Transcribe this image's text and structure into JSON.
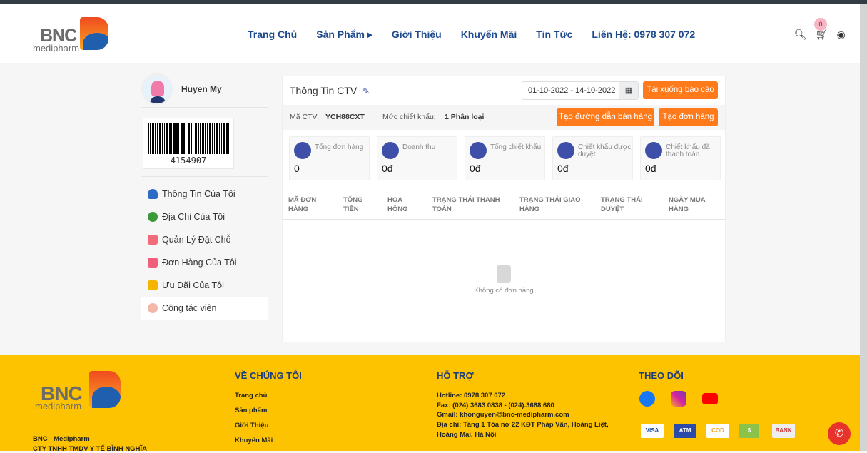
{
  "header": {
    "logo_text": "BNC medipharm",
    "nav": [
      "Trang Chủ",
      "Sản Phẩm ▸",
      "Giới Thiệu",
      "Khuyến Mãi",
      "Tin Tức",
      "Liên Hệ: 0978 307 072"
    ],
    "cart_count": "0"
  },
  "sidebar": {
    "user_name": "Huyen My",
    "barcode": "4154907",
    "items": [
      {
        "label": "Thông Tin Của Tôi",
        "color": "#2b6cc4"
      },
      {
        "label": "Địa Chỉ Của Tôi",
        "color": "#3a9a3a"
      },
      {
        "label": "Quản Lý Đặt Chỗ",
        "color": "#f26b7a"
      },
      {
        "label": "Đơn Hàng Của Tôi",
        "color": "#f0607a"
      },
      {
        "label": "Ưu Đãi Của Tôi",
        "color": "#f5b400"
      },
      {
        "label": "Cộng tác viên",
        "color": "#f4b8a8"
      }
    ]
  },
  "panel": {
    "title": "Thông Tin CTV",
    "date_range": "01-10-2022 - 14-10-2022",
    "download_btn": "Tải xuống báo cáo",
    "ctv_label": "Mã CTV:",
    "ctv_code": "YCH88CXT",
    "discount_label": "Mức chiết khấu:",
    "discount_value": "1 Phân loại",
    "link_btn": "Tạo đường dẫn bán hàng",
    "order_btn": "Tạo đơn hàng",
    "stats": [
      {
        "label": "Tổng đơn hàng",
        "value": "0"
      },
      {
        "label": "Doanh thu",
        "value": "0đ"
      },
      {
        "label": "Tổng chiết khấu",
        "value": "0đ"
      },
      {
        "label": "Chiết khấu được duyệt",
        "value": "0đ"
      },
      {
        "label": "Chiết khấu đã thanh toán",
        "value": "0đ"
      }
    ],
    "columns": [
      "MÃ ĐƠN HÀNG",
      "TỔNG TIỀN",
      "HOA HỒNG",
      "TRẠNG THÁI THANH TOÁN",
      "TRẠNG THÁI GIAO HÀNG",
      "TRẠNG THÁI DUYỆT",
      "NGÀY MUA HÀNG"
    ],
    "empty": "Không có đơn hàng"
  },
  "footer": {
    "company": "BNC - Medipharm",
    "company_full": "CTY TNHH TMDV Y TẾ BÌNH NGHĨA",
    "about_title": "VỀ CHÚNG TÔI",
    "about_links": [
      "Trang chủ",
      "Sản phẩm",
      "Giới Thiệu",
      "Khuyến Mãi"
    ],
    "support_title": "HỖ TRỢ",
    "support_lines": [
      "Hotline: 0978 307 072",
      "Fax: (024) 3683 0838 - (024).3668 680",
      "Gmail: khonguyen@bnc-medipharm.com",
      "Địa chỉ: Tầng 1 Tòa nơ 22 KĐT Pháp Vân, Hoàng Liệt, Hoàng Mai, Hà Nội"
    ],
    "follow_title": "THEO DÕI",
    "payments": [
      "VISA",
      "ATM",
      "COD",
      "$",
      "BANK"
    ]
  }
}
